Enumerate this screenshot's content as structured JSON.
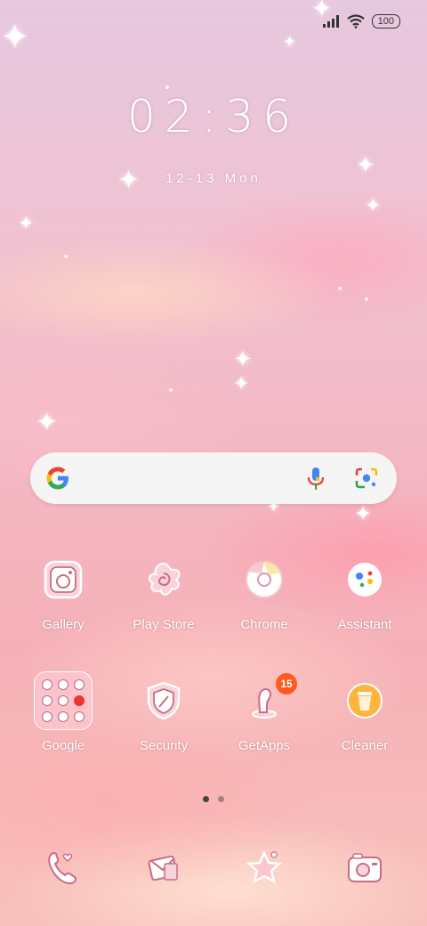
{
  "status_bar": {
    "battery": "100",
    "signal_icon": "signal-icon",
    "wifi_icon": "wifi-icon"
  },
  "clock": {
    "time": "02:36",
    "date": "12-13 Mon"
  },
  "search": {
    "google_icon": "google-g-icon",
    "mic_icon": "mic-icon",
    "lens_icon": "lens-icon"
  },
  "apps_row1": [
    {
      "label": "Gallery",
      "icon": "gallery-icon"
    },
    {
      "label": "Play Store",
      "icon": "play-store-icon"
    },
    {
      "label": "Chrome",
      "icon": "chrome-icon"
    },
    {
      "label": "Assistant",
      "icon": "assistant-icon"
    }
  ],
  "apps_row2": [
    {
      "label": "Google",
      "icon": "google-folder-icon"
    },
    {
      "label": "Security",
      "icon": "security-icon"
    },
    {
      "label": "GetApps",
      "icon": "getapps-icon",
      "badge": "15"
    },
    {
      "label": "Cleaner",
      "icon": "cleaner-icon"
    }
  ],
  "page_indicator": {
    "count": 2,
    "active": 0
  },
  "dock": [
    {
      "icon": "phone-icon"
    },
    {
      "icon": "messages-icon"
    },
    {
      "icon": "themes-icon"
    },
    {
      "icon": "camera-icon"
    }
  ],
  "colors": {
    "badge": "#ff5a1f",
    "accent_pink": "#c96d86"
  }
}
